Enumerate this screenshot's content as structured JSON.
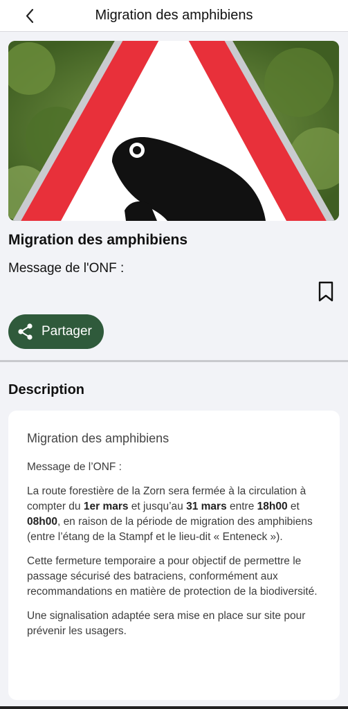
{
  "header": {
    "title": "Migration des amphibiens",
    "back_icon": "chevron-left-icon"
  },
  "hero_image": {
    "subject": "amphibian-crossing-warning-sign",
    "colors": {
      "sign_border": "#e8303a",
      "frog": "#111111",
      "foliage": "#5b7d33"
    }
  },
  "article": {
    "title": "Migration des amphibiens",
    "subtitle": "Message de l'ONF :",
    "bookmark_icon": "bookmark-icon",
    "share_label": "Partager",
    "share_icon": "share-icon"
  },
  "description": {
    "section_title": "Description",
    "card_title": "Migration des amphibiens",
    "intro": "Message de l’ONF :",
    "p1": {
      "t1": "La route forestière de la Zorn sera fermée à la circulation à compter du ",
      "b1": "1er mars",
      "t2": " et jusqu’au ",
      "b2": "31 mars",
      "t3": " entre ",
      "b3": "18h00",
      "t4": " et ",
      "b4": "08h00",
      "t5": ", en raison de la période de migration des amphibiens (entre l’étang de la Stampf et le lieu-dit « Enteneck »)."
    },
    "p2": "Cette fermeture temporaire a pour objectif de permettre le passage sécurisé des batraciens, conformément aux recommandations en matière de protection de la biodiversité.",
    "p3": "Une signalisation adaptée sera mise en place sur site pour prévenir les usagers."
  },
  "theme": {
    "share_button_bg": "#2f5a3b",
    "page_bg": "#f2f3f7"
  }
}
